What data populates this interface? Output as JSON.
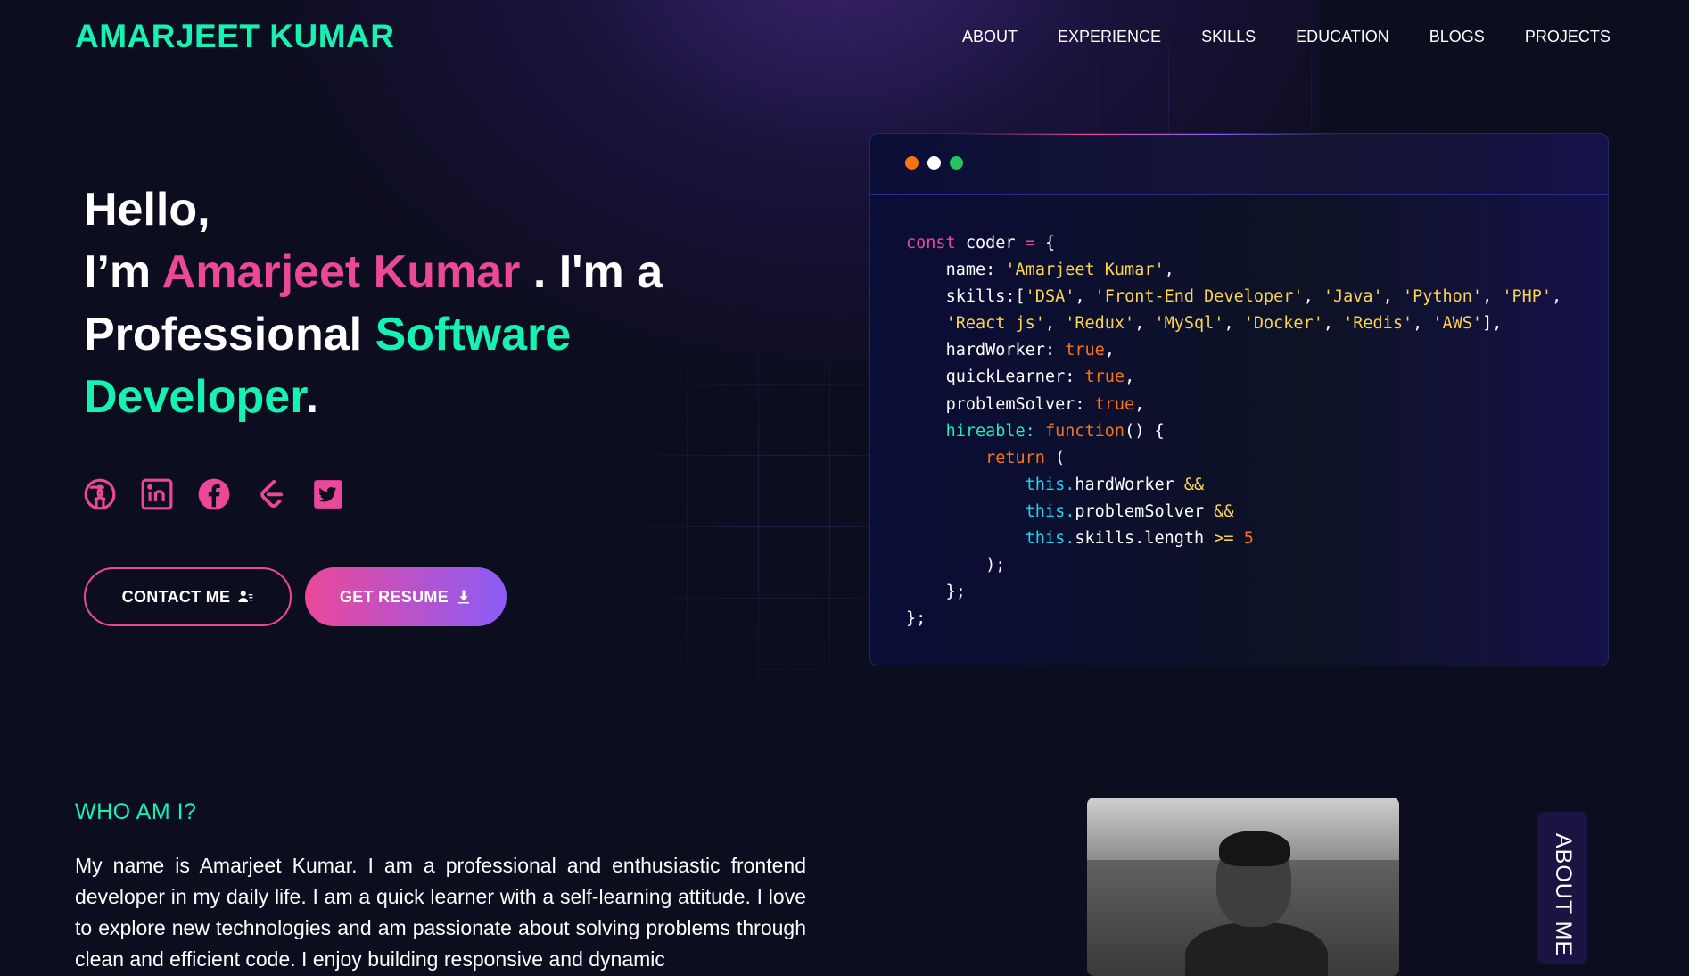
{
  "header": {
    "brand": "AMARJEET KUMAR",
    "nav": [
      "ABOUT",
      "EXPERIENCE",
      "SKILLS",
      "EDUCATION",
      "BLOGS",
      "PROJECTS"
    ]
  },
  "hero": {
    "hello": "Hello,",
    "im": "I’m ",
    "name": "Amarjeet Kumar",
    "after_name": " . I'm a",
    "professional": "Professional ",
    "software": "Software",
    "developer": "Developer",
    "period": "."
  },
  "socials": [
    "github-icon",
    "linkedin-icon",
    "facebook-icon",
    "leetcode-icon",
    "twitter-icon"
  ],
  "buttons": {
    "contact": "CONTACT ME",
    "resume": "GET RESUME"
  },
  "code": {
    "dots": [
      "#f97316",
      "#ffffff",
      "#22c55e"
    ],
    "const_kw": "const",
    "var_name": "coder",
    "name_key": "name:",
    "name_val": "'Amarjeet Kumar'",
    "skills_key": "skills:",
    "skills_line1": [
      "'DSA'",
      "'Front-End Developer'",
      "'Java'",
      "'Python'",
      "'PHP'"
    ],
    "skills_line2": [
      "'React js'",
      "'Redux'",
      "'MySql'",
      "'Docker'",
      "'Redis'",
      "'AWS'"
    ],
    "hard_key": "hardWorker:",
    "quick_key": "quickLearner:",
    "problem_key": "problemSolver:",
    "true_val": "true",
    "hireable_key": "hireable:",
    "function_kw": "function",
    "return_kw": "return",
    "this_kw": "this.",
    "hardWorker": "hardWorker",
    "problemSolver": "problemSolver",
    "skills_length": "skills.length",
    "and_op": "&&",
    "gte_op": ">=",
    "five": "5"
  },
  "about": {
    "heading": "WHO AM I?",
    "text": "My name is Amarjeet Kumar. I am a professional and enthusiastic frontend developer in my daily life. I am a quick learner with a self-learning attitude. I love to explore new technologies and am passionate about solving problems through clean and efficient code. I enjoy building responsive and dynamic",
    "side_tab": "ABOUT ME"
  },
  "colors": {
    "accent_green": "#16f2b3",
    "accent_pink": "#ec4899",
    "accent_violet": "#8b5cf6",
    "background": "#0d0d20"
  }
}
